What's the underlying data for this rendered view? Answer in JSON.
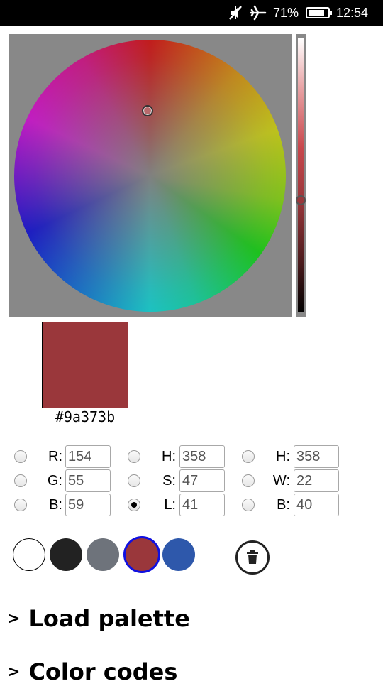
{
  "status_bar": {
    "battery_percent": "71%",
    "time": "12:54",
    "icons": [
      "mute-icon",
      "airplane-icon",
      "battery-icon"
    ]
  },
  "color_picker": {
    "hex": "#9a373b",
    "current_color": "#9a373b"
  },
  "rgb": {
    "r_label": "R:",
    "r_value": "154",
    "g_label": "G:",
    "g_value": "55",
    "b_label": "B:",
    "b_value": "59"
  },
  "hsl": {
    "h_label": "H:",
    "h_value": "358",
    "s_label": "S:",
    "s_value": "47",
    "l_label": "L:",
    "l_value": "41",
    "selected": "L"
  },
  "hwb": {
    "h_label": "H:",
    "h_value": "358",
    "w_label": "W:",
    "w_value": "22",
    "b_label": "B:",
    "b_value": "40"
  },
  "palette": {
    "colors": [
      "#ffffff",
      "#222222",
      "#6e737b",
      "#9a373b",
      "#2e58ab"
    ],
    "selected_index": 3
  },
  "sections": {
    "load_palette": "Load palette",
    "color_codes": "Color codes"
  }
}
